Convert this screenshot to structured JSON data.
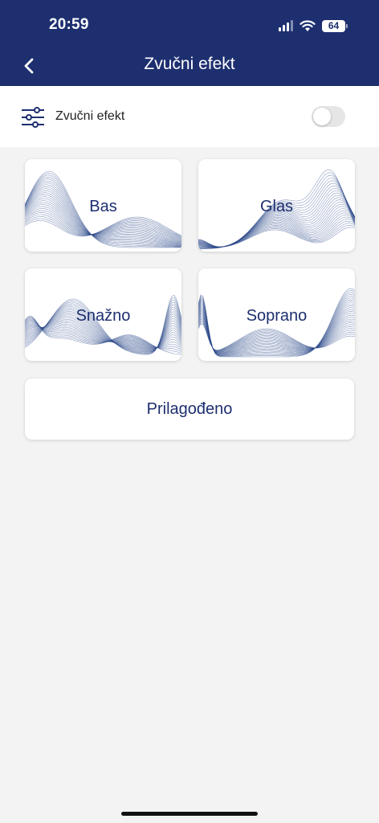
{
  "status_bar": {
    "time": "20:59",
    "battery": "64"
  },
  "header": {
    "title": "Zvučni efekt"
  },
  "toggle": {
    "label": "Zvučni efekt",
    "enabled": false
  },
  "presets": [
    {
      "label": "Bas"
    },
    {
      "label": "Glas"
    },
    {
      "label": "Snažno"
    },
    {
      "label": "Soprano"
    }
  ],
  "custom": {
    "label": "Prilagođeno"
  },
  "colors": {
    "brand": "#1d2f6f",
    "wave": "#2e4a8a"
  }
}
